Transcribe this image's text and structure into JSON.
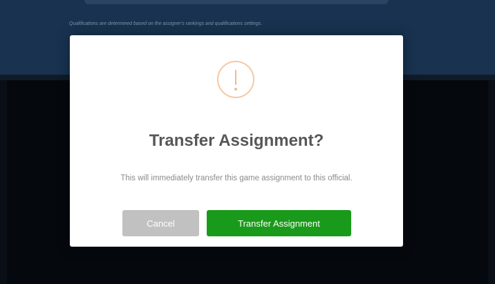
{
  "background": {
    "qualifications_note": "Qualifications are determined based on the assigner's rankings and qualifications settings."
  },
  "modal": {
    "icon": "exclamation-circle-icon",
    "title": "Transfer Assignment?",
    "message": "This will immediately transfer this game assignment to this official.",
    "cancel_label": "Cancel",
    "confirm_label": "Transfer Assignment"
  },
  "colors": {
    "confirm_button": "#1a9a1a",
    "cancel_button": "#c1c1c1",
    "icon_accent": "#f0b98c",
    "header_background": "#18324f"
  }
}
